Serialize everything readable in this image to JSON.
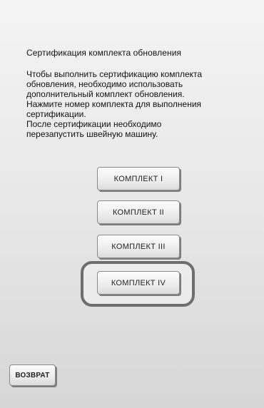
{
  "screen": {
    "title": "Сертификация комплекта обновления",
    "instructions": [
      "Чтобы выполнить сертификацию комплекта",
      "обновления, необходимо использовать",
      "дополнительный комплект обновления.",
      "Нажмите номер комплекта для выполнения",
      "сертификации.",
      "После сертификации необходимо",
      "перезапустить швейную машину."
    ]
  },
  "kits": [
    {
      "label": "КОМПЛЕКТ I"
    },
    {
      "label": "КОМПЛЕКТ II"
    },
    {
      "label": "КОМПЛЕКТ III"
    },
    {
      "label": "КОМПЛЕКТ IV"
    }
  ],
  "highlighted_kit": "КОМПЛЕКТ IV",
  "footer": {
    "back_label": "ВОЗВРАТ"
  }
}
